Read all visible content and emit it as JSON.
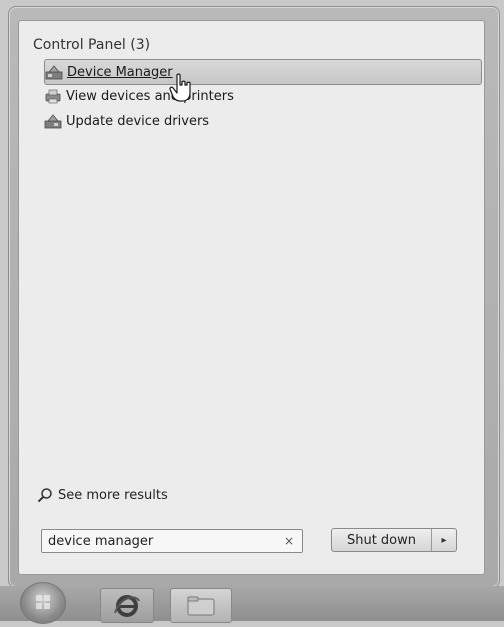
{
  "results": {
    "header": "Control Panel (3)",
    "items": [
      {
        "label": "Device Manager",
        "icon": "device-manager-icon",
        "selected": true
      },
      {
        "label": "View devices and printers",
        "icon": "devices-printers-icon",
        "selected": false
      },
      {
        "label": "Update device drivers",
        "icon": "device-drivers-icon",
        "selected": false
      }
    ]
  },
  "see_more": {
    "label": "See more results",
    "icon": "search-icon"
  },
  "search": {
    "value": "device manager",
    "clear_glyph": "×"
  },
  "shutdown": {
    "label": "Shut down",
    "arrow_glyph": "▸"
  },
  "taskbar": {
    "items": [
      "start-orb",
      "internet-explorer-icon",
      "windows-explorer-icon"
    ]
  }
}
